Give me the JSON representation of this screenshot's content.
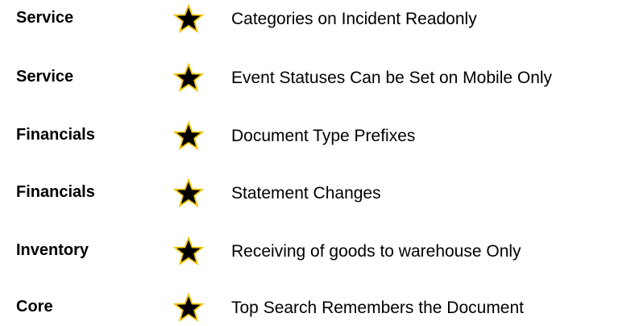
{
  "star_colors": {
    "fill": "#000000",
    "outline": "#F2C500"
  },
  "rows": [
    {
      "module": "Service",
      "feature": "Categories on Incident Readonly",
      "icon": "star-icon"
    },
    {
      "module": "Service",
      "feature": "Event Statuses Can be Set on Mobile Only",
      "icon": "star-icon"
    },
    {
      "module": "Financials",
      "feature": "Document Type Prefixes",
      "icon": "star-icon"
    },
    {
      "module": "Financials",
      "feature": "Statement Changes",
      "icon": "star-icon"
    },
    {
      "module": "Inventory",
      "feature": "Receiving of goods to warehouse Only",
      "icon": "star-icon"
    },
    {
      "module": "Core",
      "feature": "Top Search Remembers the Document",
      "icon": "star-icon"
    }
  ]
}
